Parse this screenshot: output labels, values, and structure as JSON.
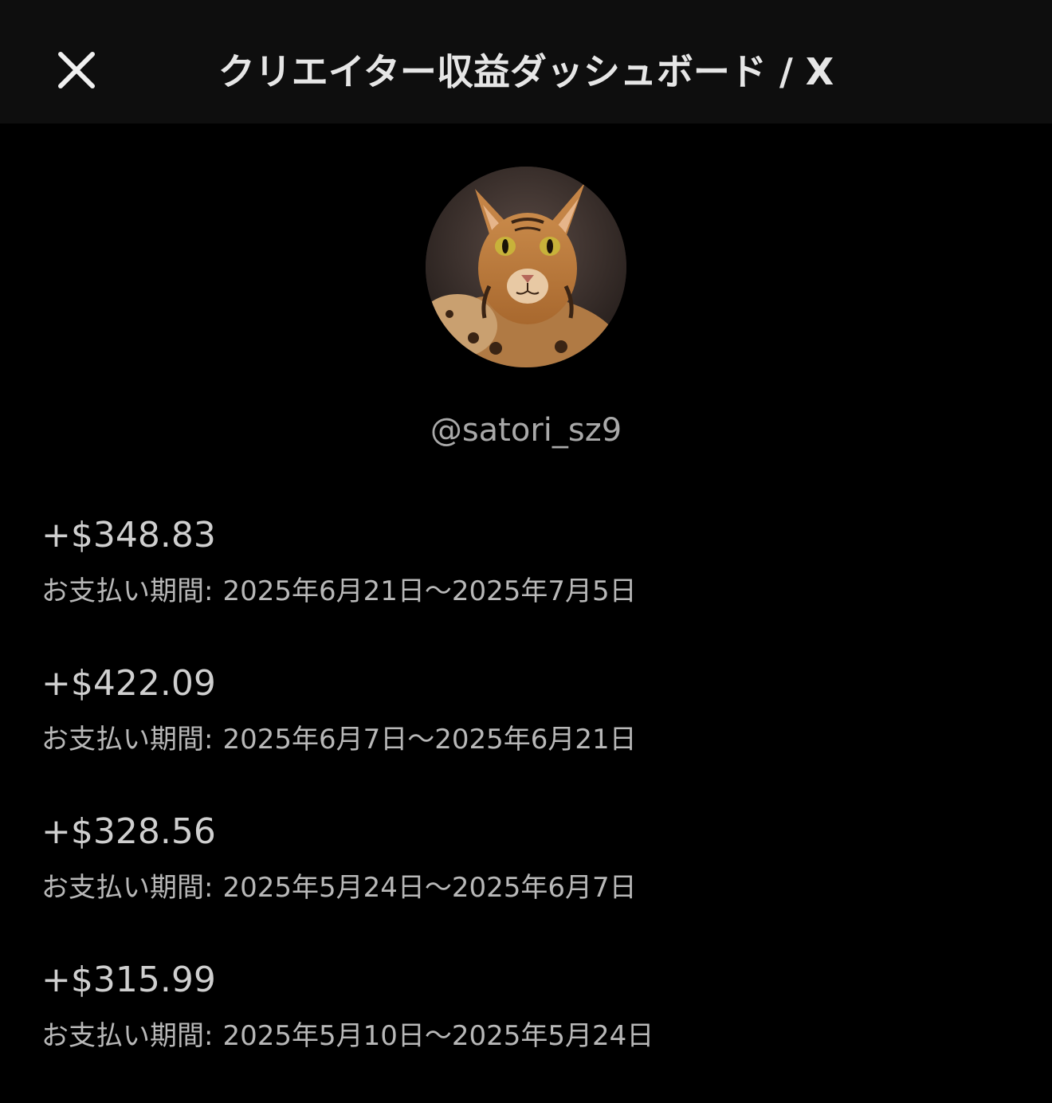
{
  "header": {
    "title": "クリエイター収益ダッシュボード / X",
    "close_icon": "close-icon"
  },
  "profile": {
    "avatar_icon": "cat-avatar",
    "username": "@satori_sz9"
  },
  "payouts": [
    {
      "amount": "+$348.83",
      "period_label": "お支払い期間:",
      "period_range": "2025年6月21日〜2025年7月5日"
    },
    {
      "amount": "+$422.09",
      "period_label": "お支払い期間:",
      "period_range": "2025年6月7日〜2025年6月21日"
    },
    {
      "amount": "+$328.56",
      "period_label": "お支払い期間:",
      "period_range": "2025年5月24日〜2025年6月7日"
    },
    {
      "amount": "+$315.99",
      "period_label": "お支払い期間:",
      "period_range": "2025年5月10日〜2025年5月24日"
    }
  ],
  "colors": {
    "background": "#000000",
    "header_background": "#0e0e0e",
    "text_primary": "#e6e6e6",
    "text_secondary": "#b8b8b8"
  }
}
